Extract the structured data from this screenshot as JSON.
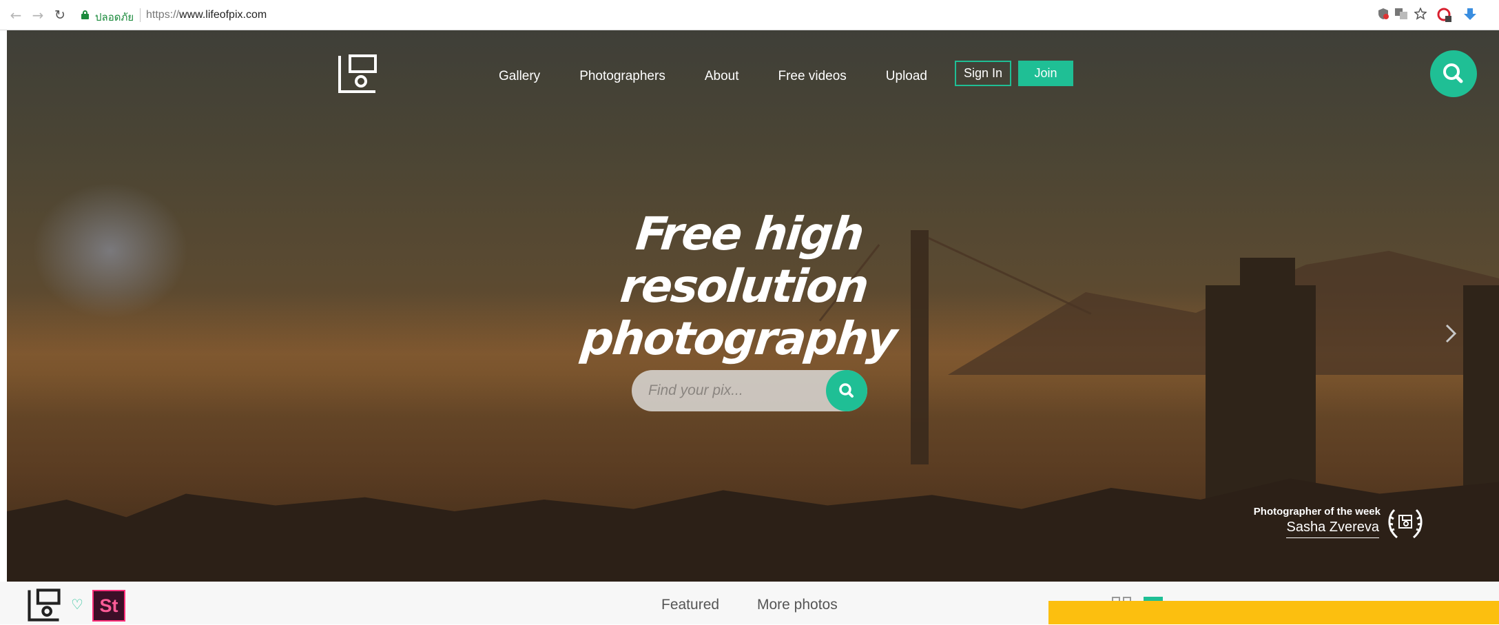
{
  "browser": {
    "secure_label": "ปลอดภัย",
    "url_scheme": "https://",
    "url_host": "www.lifeofpix.com",
    "back_glyph": "←",
    "forward_glyph": "→",
    "reload_glyph": "↻",
    "extensions": [
      "shield-icon",
      "translate-icon",
      "star-icon",
      "user-icon",
      "download-icon"
    ]
  },
  "nav": {
    "items": [
      "Gallery",
      "Photographers",
      "About",
      "Free videos",
      "Upload"
    ],
    "sign_in": "Sign In",
    "join": "Join"
  },
  "hero": {
    "headline_line1": "Free high resolution",
    "headline_line2": "photography",
    "search_placeholder": "Find your pix...",
    "photographer_label": "Photographer of the week",
    "photographer_name": "Sasha Zvereva"
  },
  "bottom": {
    "heart_glyph": "♡",
    "stock_badge": "St",
    "tabs": [
      "Featured",
      "More photos"
    ]
  },
  "colors": {
    "accent": "#1fbf95",
    "promo": "#fcbf0f",
    "stock_pink": "#ff2f7a"
  }
}
